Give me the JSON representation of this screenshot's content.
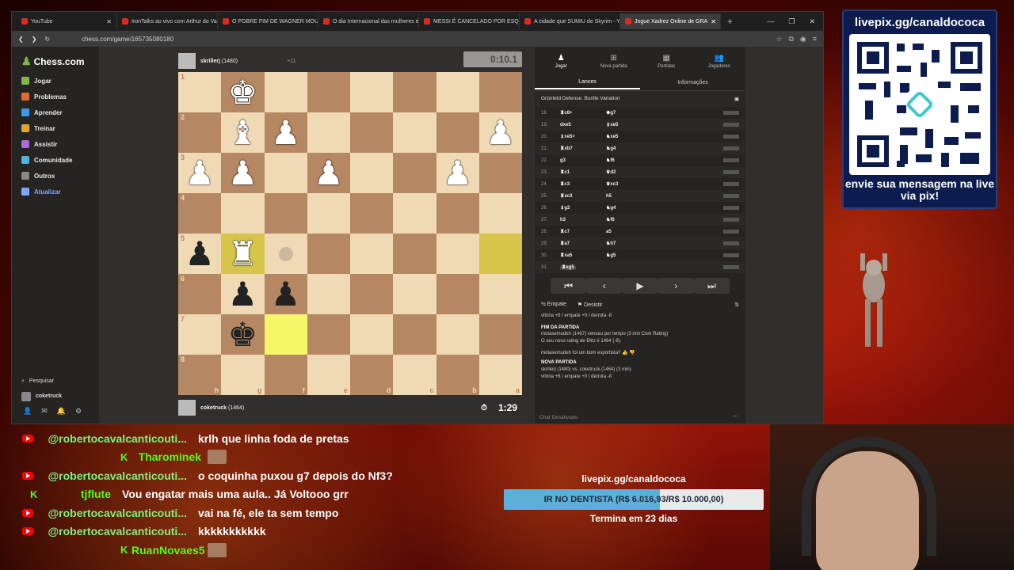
{
  "browser": {
    "tabs": [
      {
        "label": "YouTube",
        "active": false
      },
      {
        "label": "IronTalks ao vivo com Arthur do Val",
        "active": false
      },
      {
        "label": "O POBRE FIM DE WAGNER MOURA",
        "active": false
      },
      {
        "label": "O dia Internacional das mulheres é u",
        "active": false
      },
      {
        "label": "MESSI É CANCELADO POR ESQUER",
        "active": false
      },
      {
        "label": "A cidade que SUMIU de Skyrim - Yo",
        "active": false
      },
      {
        "label": "Jogue Xadrez Online de GRA",
        "active": true
      }
    ],
    "new_tab": "+",
    "url": "chess.com/game/165735080180"
  },
  "sidebar": {
    "logo": "Chess.com",
    "items": [
      {
        "label": "Jogar",
        "color": "#81b64c"
      },
      {
        "label": "Problemas",
        "color": "#e06b2b"
      },
      {
        "label": "Aprender",
        "color": "#3b9be8"
      },
      {
        "label": "Treinar",
        "color": "#e0a62b"
      },
      {
        "label": "Assistir",
        "color": "#aa6bd8"
      },
      {
        "label": "Comunidade",
        "color": "#4fb3d8"
      },
      {
        "label": "Outros",
        "color": "#888888"
      },
      {
        "label": "Atualizar",
        "color": "#7fa6ff"
      }
    ],
    "search": "Pesquisar",
    "user": "coketruck"
  },
  "game": {
    "top_player": {
      "name": "skrillerj",
      "rating": "(1480)",
      "extra": "+11"
    },
    "top_clock": "0:10.1",
    "bottom_player": {
      "name": "coketruck",
      "rating": "(1464)"
    },
    "bottom_clock": "1:29",
    "ranks": [
      "1",
      "2",
      "3",
      "4",
      "5",
      "6",
      "7",
      "8"
    ],
    "files": [
      "h",
      "g",
      "f",
      "e",
      "d",
      "c",
      "b",
      "a"
    ],
    "pieces": {
      "0,1": {
        "glyph": "♚",
        "color": "white"
      },
      "1,1": {
        "glyph": "♝",
        "color": "white"
      },
      "1,2": {
        "glyph": "♟",
        "color": "white"
      },
      "1,7": {
        "glyph": "♟",
        "color": "white"
      },
      "2,0": {
        "glyph": "♟",
        "color": "white"
      },
      "2,1": {
        "glyph": "♟",
        "color": "white"
      },
      "2,3": {
        "glyph": "♟",
        "color": "white"
      },
      "2,6": {
        "glyph": "♟",
        "color": "white"
      },
      "4,0": {
        "glyph": "♟",
        "color": "black"
      },
      "4,1": {
        "glyph": "♜",
        "color": "white"
      },
      "5,1": {
        "glyph": "♟",
        "color": "black"
      },
      "5,2": {
        "glyph": "♟",
        "color": "black"
      },
      "6,1": {
        "glyph": "♚",
        "color": "black"
      }
    },
    "highlights": [
      "4,1",
      "4,7",
      "6,2"
    ],
    "dots": [
      "4,2"
    ]
  },
  "panel": {
    "tabs": [
      {
        "label": "Jogar",
        "icon": "♟"
      },
      {
        "label": "Nova partida",
        "icon": "⊞"
      },
      {
        "label": "Partidas",
        "icon": "▦"
      },
      {
        "label": "Jogadores",
        "icon": "👥"
      }
    ],
    "subtabs": [
      "Lances",
      "Informações"
    ],
    "opening": "Grünfeld Defense: Burille Variation",
    "moves": [
      {
        "n": "18.",
        "w": "♜c8+",
        "b": "♚g7"
      },
      {
        "n": "19.",
        "w": "dxe5",
        "b": "♝xe5"
      },
      {
        "n": "20.",
        "w": "♝xe5+",
        "b": "♞xe5"
      },
      {
        "n": "21.",
        "w": "♜xb7",
        "b": "♞g4"
      },
      {
        "n": "22.",
        "w": "g3",
        "b": "♞f6"
      },
      {
        "n": "23.",
        "w": "♜c1",
        "b": "♛d2"
      },
      {
        "n": "24.",
        "w": "♜c3",
        "b": "♛xc3"
      },
      {
        "n": "25.",
        "w": "♜xc3",
        "b": "h5"
      },
      {
        "n": "26.",
        "w": "♝g2",
        "b": "♞g4"
      },
      {
        "n": "27.",
        "w": "h3",
        "b": "♞f6"
      },
      {
        "n": "28.",
        "w": "♜c7",
        "b": "a5"
      },
      {
        "n": "29.",
        "w": "♜a7",
        "b": "♞h7"
      },
      {
        "n": "30.",
        "w": "♜xa5",
        "b": "♞g5"
      },
      {
        "n": "31.",
        "w": "♜xg5",
        "b": ""
      }
    ],
    "draw": "Empate",
    "resign": "Desistir",
    "log": {
      "line1": "vitória +8 / empate +0 / derrota -8",
      "end_title": "FIM DA PARTIDA",
      "end_line": "motasemudeh (1467) venceu por tempo (3 min Com Rating)",
      "rating_line": "O seu novo rating de Blitz é 1464 (-8).",
      "sport": "motasemudeh foi um bom esportista?",
      "new_title": "NOVA PARTIDA",
      "new_line": "skrillerj (1480) vs. coketruck (1464) (3 min)",
      "new_line2": "vitória +8 / empate +0 / derrota -8"
    },
    "chat_status": "Chat Desativado"
  },
  "qr": {
    "title": "livepix.gg/canaldococa",
    "subtitle": "envie sua mensagem na live via pix!"
  },
  "chat": [
    {
      "platform": "youtube",
      "name": "@robertocavalcanticouti...",
      "text": "krlh que linha foda de pretas"
    },
    {
      "platform": "kick",
      "name": "Tharominek",
      "text": ""
    },
    {
      "platform": "youtube",
      "name": "@robertocavalcanticouti...",
      "text": "o coquinha puxou g7 depois do Nf3?"
    },
    {
      "platform": "kick",
      "name": "tjflute",
      "text": "Vou engatar mais uma aula.. Já Voltooo grr"
    },
    {
      "platform": "youtube",
      "name": "@robertocavalcanticouti...",
      "text": "vai na fé, ele ta sem tempo"
    },
    {
      "platform": "youtube",
      "name": "@robertocavalcanticouti...",
      "text": "kkkkkkkkkkk"
    },
    {
      "platform": "kick",
      "name": "RuanNovaes5",
      "text": ""
    }
  ],
  "goal": {
    "url": "livepix.gg/canaldococa",
    "label": "IR NO DENTISTA (R$ 6.016,93/R$ 10.000,00)",
    "progress": 0.6017,
    "remaining": "Termina em 23 dias"
  }
}
